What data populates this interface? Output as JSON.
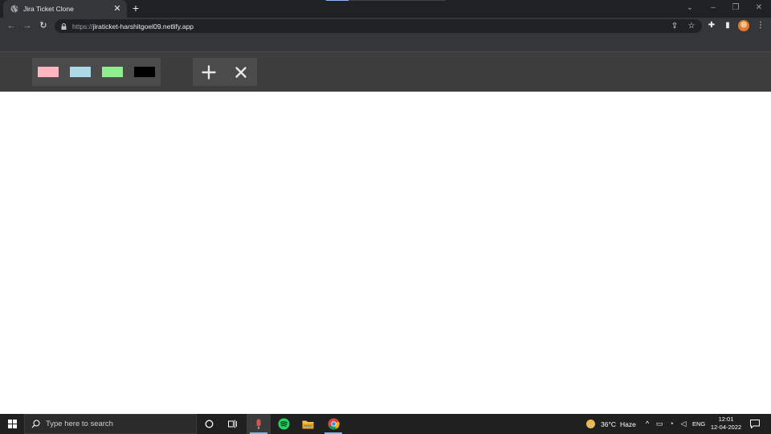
{
  "browser": {
    "tab_title": "Jira Ticket Clone",
    "tab_close_icon": "close-icon",
    "new_tab_label": "+",
    "url_scheme": "https://",
    "url_host": "jiraticket-harshitgoel09.netlify.app"
  },
  "app": {
    "colors": [
      {
        "name": "pink",
        "hex": "#ffb6c1"
      },
      {
        "name": "lightblue",
        "hex": "#add8e6"
      },
      {
        "name": "lightgreen",
        "hex": "#90ee90"
      },
      {
        "name": "black",
        "hex": "#000000"
      }
    ],
    "actions": [
      {
        "name": "add",
        "icon": "plus-icon"
      },
      {
        "name": "remove",
        "icon": "close-icon"
      }
    ]
  },
  "taskbar": {
    "search_placeholder": "Type here to search",
    "weather_temp": "36°C",
    "weather_desc": "Haze",
    "language": "ENG",
    "time": "12:01",
    "date": "12-04-2022"
  }
}
